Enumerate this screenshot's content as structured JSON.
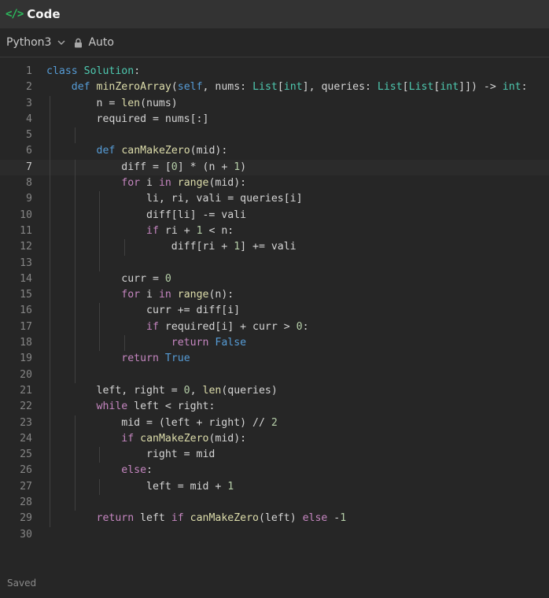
{
  "header": {
    "title": "Code",
    "icon": "code-brackets-icon",
    "accent": "#2cbb5d"
  },
  "toolbar": {
    "language": "Python3",
    "mode": "Auto"
  },
  "editor": {
    "active_line": 7,
    "lines": [
      "class Solution:",
      "    def minZeroArray(self, nums: List[int], queries: List[List[int]]) -> int:",
      "        n = len(nums)",
      "        required = nums[:]",
      "",
      "        def canMakeZero(mid):",
      "            diff = [0] * (n + 1)",
      "            for i in range(mid):",
      "                li, ri, vali = queries[i]",
      "                diff[li] -= vali",
      "                if ri + 1 < n:",
      "                    diff[ri + 1] += vali",
      "",
      "            curr = 0",
      "            for i in range(n):",
      "                curr += diff[i]",
      "                if required[i] + curr > 0:",
      "                    return False",
      "            return True",
      "",
      "        left, right = 0, len(queries)",
      "        while left < right:",
      "            mid = (left + right) // 2",
      "            if canMakeZero(mid):",
      "                right = mid",
      "            else:",
      "                left = mid + 1",
      "",
      "        return left if canMakeZero(left) else -1",
      ""
    ]
  },
  "status": {
    "text": "Saved"
  }
}
